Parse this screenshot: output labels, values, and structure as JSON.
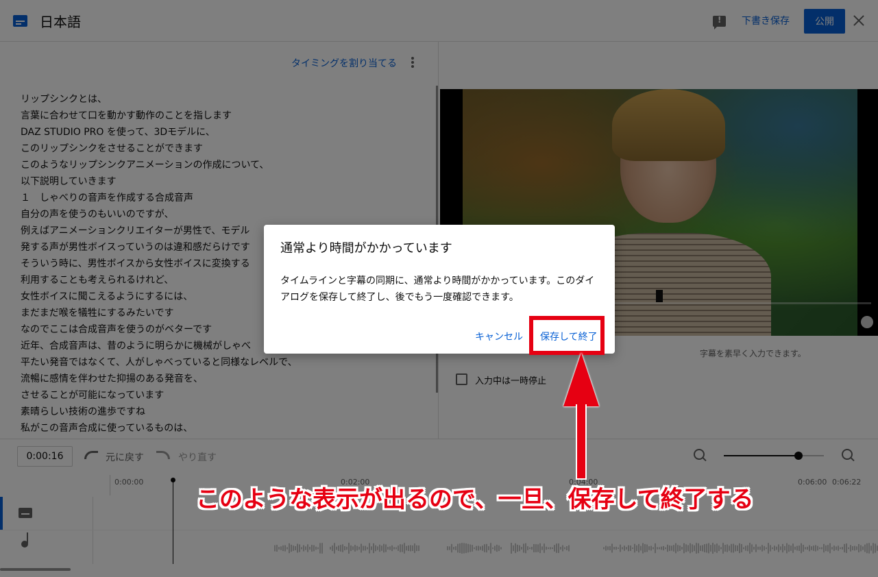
{
  "header": {
    "title": "日本語",
    "save_draft": "下書き保存",
    "publish": "公開"
  },
  "left_panel": {
    "assign_timing": "タイミングを割り当てる",
    "transcript_lines": [
      "リップシンクとは、",
      "言葉に合わせて口を動かす動作のことを指します",
      "DAZ STUDIO PRO を使って、3Dモデルに、",
      "このリップシンクをさせることができます",
      "このようなリップシンクアニメーションの作成について、",
      "以下説明していきます",
      "１　しゃべりの音声を作成する合成音声",
      "自分の声を使うのもいいのですが、",
      "例えばアニメーションクリエイターが男性で、モデル",
      "発する声が男性ボイスっていうのは違和感だらけです",
      "そういう時に、男性ボイスから女性ボイスに変換する",
      "利用することも考えられるけれど、",
      "女性ボイスに聞こえるようにするには、",
      "まだまだ喉を犠牲にするみたいです",
      "なのでここは合成音声を使うのがベターです",
      "近年、合成音声は、昔のように明らかに機械がしゃべ",
      "平たい発音ではなくて、人がしゃべっていると同様なレベルで、",
      "流暢に感情を伴わせた抑揚のある発音を、",
      "させることが可能になっています",
      "素晴らしい技術の進歩ですね",
      "私がこの音声合成に使っているものは、"
    ]
  },
  "right_panel": {
    "hint_text": "字幕を素早く入力できます。",
    "pause_label": "入力中は一時停止"
  },
  "timeline": {
    "current_time": "0:00:16",
    "undo": "元に戻す",
    "redo": "やり直す",
    "ruler": [
      "0:00:00",
      "0:02:00",
      "0:04:00",
      "0:06:00",
      "0:06:22"
    ],
    "zoom_level": 0.75
  },
  "dialog": {
    "title": "通常より時間がかかっています",
    "body": "タイムラインと字幕の同期に、通常より時間がかかっています。このダイアログを保存して終了し、後でもう一度確認できます。",
    "cancel": "キャンセル",
    "save_and_close": "保存して終了"
  },
  "annotation": {
    "callout": "このような表示が出るので、一旦、保存して終了する",
    "color": "#e60012"
  }
}
